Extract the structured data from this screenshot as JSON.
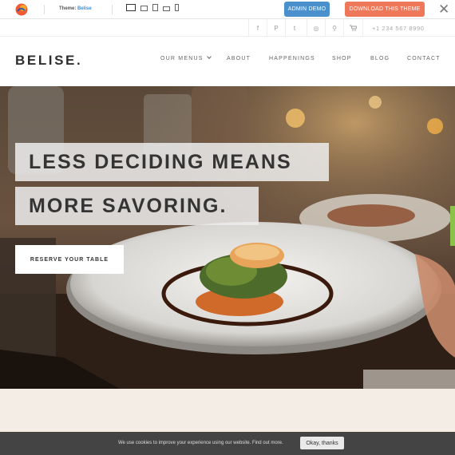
{
  "demo_bar": {
    "theme_label": "Theme:",
    "theme_name": "Belise",
    "admin_demo_label": "ADMIN DEMO",
    "download_label": "DOWNLOAD THIS THEME",
    "close_glyph": "✕",
    "device_icons": [
      "desktop-icon",
      "laptop-icon",
      "tablet-icon",
      "tablet-landscape-icon",
      "phone-icon"
    ]
  },
  "topbar": {
    "icons": [
      {
        "name": "facebook-icon",
        "glyph": "f"
      },
      {
        "name": "pinterest-icon",
        "glyph": "P"
      },
      {
        "name": "twitter-icon",
        "glyph": "t"
      },
      {
        "name": "instagram-icon",
        "glyph": "◎"
      },
      {
        "name": "search-icon",
        "glyph": "⚲"
      },
      {
        "name": "cart-icon",
        "glyph": "🛒"
      }
    ],
    "phone": "+1 234 567 8990"
  },
  "header": {
    "brand": "BELISE.",
    "nav": [
      {
        "label": "OUR MENUS",
        "dropdown": true
      },
      {
        "label": "ABOUT"
      },
      {
        "label": "HAPPENINGS"
      },
      {
        "label": "SHOP"
      },
      {
        "label": "BLOG"
      },
      {
        "label": "CONTACT"
      }
    ]
  },
  "hero": {
    "line1": "LESS DECIDING MEANS",
    "line2": "MORE SAVORING.",
    "cta": "RESERVE YOUR TABLE"
  },
  "cookie": {
    "text": "We use cookies to improve your experience using our website. Find out more.",
    "button": "Okay, thanks"
  },
  "colors": {
    "admin_blue": "#4a90cc",
    "download_orange": "#f0785a",
    "cookie_bg": "#444444",
    "section_bg": "#f4ede5",
    "feedback_green": "#8bc34a"
  }
}
